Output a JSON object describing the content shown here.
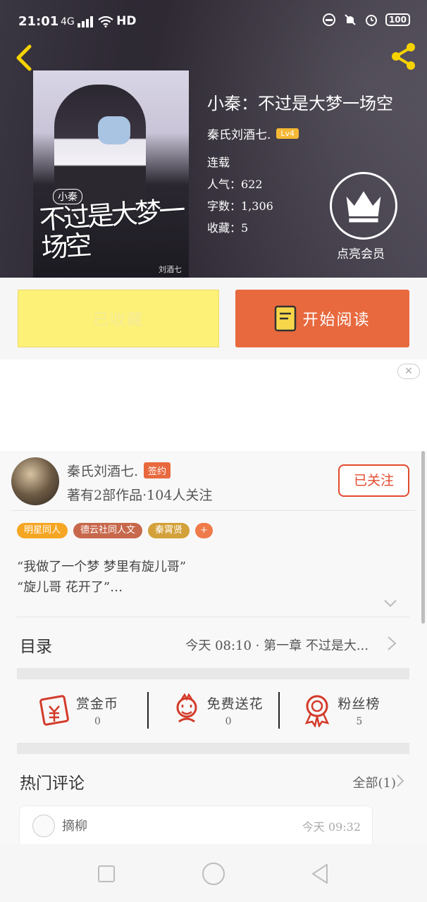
{
  "status_bar": {
    "time": "21:01",
    "signal": "4G",
    "network": "HD",
    "battery": "100"
  },
  "book": {
    "title": "小秦：不过是大梦一场空",
    "author": "秦氏刘酒七.",
    "level": "Lv4",
    "status": "连载",
    "popularity": "人气：622",
    "word_count": "字数：1,306",
    "favorites": "收藏：5",
    "vip_label": "点亮会员",
    "cover_tag": "小秦",
    "cover_title": "不过是大梦一场空",
    "cover_signature": "刘酒七"
  },
  "actions": {
    "favorited_label": "已收藏",
    "read_label": "开始阅读"
  },
  "ad": {
    "close_label": "✕"
  },
  "author_card": {
    "name": "秦氏刘酒七.",
    "sign_badge": "签约",
    "stats": "著有2部作品·104人关注",
    "follow_label": "已关注"
  },
  "tags": [
    {
      "label": "明星同人",
      "color": "#f5a623"
    },
    {
      "label": "德云社同人文",
      "color": "#c7684c"
    },
    {
      "label": "秦霄贤",
      "color": "#d3a13a"
    },
    {
      "label": "+",
      "color": "#ef7a4a"
    }
  ],
  "intro": {
    "line1": "“我做了一个梦 梦里有旋儿哥”",
    "line2": "“旋儿哥 花开了”…"
  },
  "toc": {
    "label": "目录",
    "latest": "今天 08:10 · 第一章 不过是大..."
  },
  "rewards": [
    {
      "label": "赏金币",
      "value": "0",
      "icon": "red-envelope-icon"
    },
    {
      "label": "免费送花",
      "value": "0",
      "icon": "flower-icon"
    },
    {
      "label": "粉丝榜",
      "value": "5",
      "icon": "medal-icon"
    }
  ],
  "comments": {
    "title": "热门评论",
    "all_label": "全部(1)",
    "first": {
      "name": "摘柳",
      "time": "今天 09:32"
    }
  },
  "colors": {
    "accent_orange": "#e8693e",
    "favorited_yellow": "#fdf178",
    "follow_red": "#e24a2c",
    "icon_red": "#d33a2a"
  }
}
